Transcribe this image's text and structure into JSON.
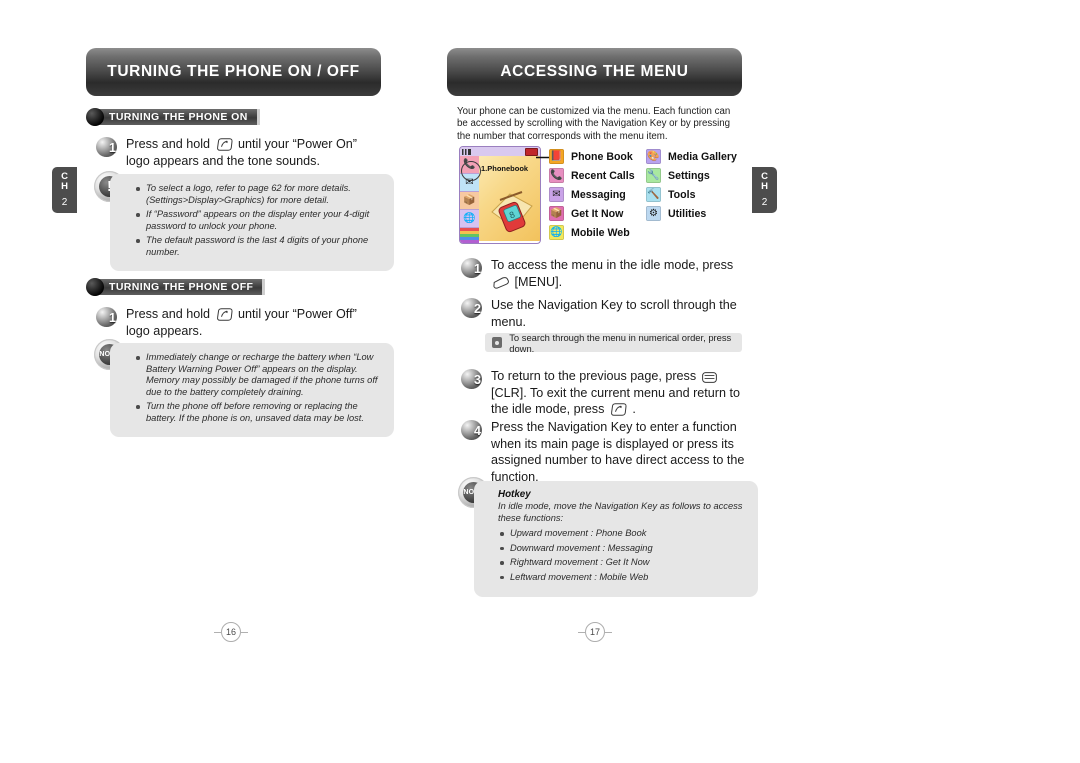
{
  "left_page": {
    "banner_title": "TURNING THE PHONE ON / OFF",
    "chapter_tab": {
      "ch": "C\nH",
      "ch_line1": "C",
      "ch_line2": "H",
      "number": "2"
    },
    "page_number": "16",
    "section_on": {
      "subhead": "TURNING THE PHONE ON",
      "step": {
        "number": "1",
        "text_before": "Press and hold",
        "key_icon": "end-power-key-icon",
        "text_after": "until your “Power On” logo appears and the tone sounds."
      },
      "note": {
        "icon": "caution-exclamation-icon",
        "bullets": [
          "To select a logo, refer to page 62 for more details. (Settings>Display>Graphics) for more detail.",
          "If “Password” appears on the display enter your 4-digit password to unlock your phone.",
          "The default password is the last 4 digits of your phone number."
        ]
      }
    },
    "section_off": {
      "subhead": "TURNING THE PHONE OFF",
      "step": {
        "number": "1",
        "text_before": "Press and hold",
        "key_icon": "end-power-key-icon",
        "text_after": "until your “Power Off” logo appears."
      },
      "note": {
        "icon": "note-icon",
        "bullets": [
          "Immediately change or recharge the battery when “Low Battery Warning Power Off” appears on the display. Memory may possibly be damaged if the phone turns off due to the battery completely draining.",
          "Turn the phone off before removing or replacing the battery. If the phone is on, unsaved data may be lost."
        ]
      }
    }
  },
  "right_page": {
    "banner_title": "ACCESSING THE MENU",
    "chapter_tab": {
      "ch_line1": "C",
      "ch_line2": "H",
      "number": "2"
    },
    "page_number": "17",
    "intro": "Your phone can be customized via the menu. Each function can be accessed by scrolling with the Navigation Key or by pressing the number that corresponds with the menu item.",
    "phone_screen": {
      "label": "1.Phonebook",
      "status_icons": [
        "signal-icon",
        "battery-icon"
      ]
    },
    "menu": {
      "column_left": [
        {
          "label": "Phone Book",
          "icon": "phone-book-icon",
          "color": "#f5a623",
          "glyph": "📕"
        },
        {
          "label": "Recent Calls",
          "icon": "recent-calls-icon",
          "color": "#e78fc0",
          "glyph": "📞"
        },
        {
          "label": "Messaging",
          "icon": "messaging-icon",
          "color": "#c9a3e8",
          "glyph": "✉"
        },
        {
          "label": "Get It Now",
          "icon": "get-it-now-icon",
          "color": "#e06fb0",
          "glyph": "📦"
        },
        {
          "label": "Mobile Web",
          "icon": "mobile-web-icon",
          "color": "#f2e85c",
          "glyph": "🌐"
        }
      ],
      "column_right": [
        {
          "label": "Media Gallery",
          "icon": "media-gallery-icon",
          "color": "#b9a3ef",
          "glyph": "🎨"
        },
        {
          "label": "Settings",
          "icon": "settings-icon",
          "color": "#a9e8a0",
          "glyph": "🔧"
        },
        {
          "label": "Tools",
          "icon": "tools-icon",
          "color": "#a9e0ef",
          "glyph": "🔨"
        },
        {
          "label": "Utilities",
          "icon": "utilities-icon",
          "color": "#bcd8f0",
          "glyph": "⚙"
        }
      ]
    },
    "steps": [
      {
        "number": "1",
        "text_before": "To access the menu in the idle mode, press",
        "key_icon": "menu-soft-key-icon",
        "text_after": "[MENU]."
      },
      {
        "number": "2",
        "text_before": "Use the Navigation Key to scroll through the menu.",
        "key_icon": "",
        "text_after": ""
      },
      {
        "number": "3",
        "text_before": "To return to the previous page, press",
        "key_icon": "clr-key-icon",
        "text_middle": "[CLR]. To exit the current menu and return to the idle mode, press",
        "key_icon_2": "end-power-key-icon",
        "text_after": "."
      },
      {
        "number": "4",
        "text_before": "Press the Navigation Key to enter a function when its main page is displayed or press its assigned number to have direct access to the function.",
        "key_icon": "",
        "text_after": ""
      }
    ],
    "strip_note": "To search through the menu in numerical order, press down.",
    "hotkey_note": {
      "icon": "note-icon",
      "title": "Hotkey",
      "intro": "In idle mode, move the Navigation Key as follows to access these functions:",
      "bullets": [
        "Upward movement : Phone Book",
        "Downward movement : Messaging",
        "Rightward movement : Get It Now",
        "Leftward movement : Mobile Web"
      ]
    }
  }
}
